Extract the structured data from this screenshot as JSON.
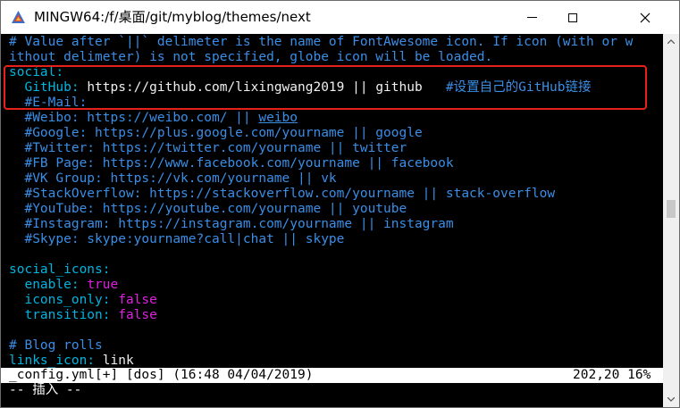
{
  "window": {
    "title": "MINGW64:/f/桌面/git/myblog/themes/next"
  },
  "editor": {
    "lines": [
      {
        "parts": [
          {
            "t": "# Value after `||` delimeter is the name of FontAwesome icon. If icon (with or w",
            "c": "c-comment"
          }
        ]
      },
      {
        "parts": [
          {
            "t": "ithout delimeter) is not specified, globe icon will be loaded.",
            "c": "c-comment"
          }
        ]
      },
      {
        "parts": [
          {
            "t": "social",
            "c": "c-key2"
          },
          {
            "t": ":",
            "c": "c-key2"
          }
        ]
      },
      {
        "parts": [
          {
            "t": "  GitHub",
            "c": "c-key2"
          },
          {
            "t": ": ",
            "c": "c-key2"
          },
          {
            "t": "https://github.com/lixingwang2019 || github",
            "c": "c-val"
          },
          {
            "t": "   #设置自己的GitHub链接",
            "c": "c-comment"
          }
        ]
      },
      {
        "parts": [
          {
            "t": "  #E-Mail:",
            "c": "c-comment"
          }
        ]
      },
      {
        "parts": [
          {
            "t": "  #Weibo: https://weibo.com/ || ",
            "c": "c-comment"
          },
          {
            "t": "weibo",
            "c": "c-comment u"
          }
        ]
      },
      {
        "parts": [
          {
            "t": "  #Google: https://plus.google.com/yourname || google",
            "c": "c-comment"
          }
        ]
      },
      {
        "parts": [
          {
            "t": "  #Twitter: https://twitter.com/yourname || twitter",
            "c": "c-comment"
          }
        ]
      },
      {
        "parts": [
          {
            "t": "  #FB Page: https://www.facebook.com/yourname || facebook",
            "c": "c-comment"
          }
        ]
      },
      {
        "parts": [
          {
            "t": "  #VK Group: https://vk.com/yourname || vk",
            "c": "c-comment"
          }
        ]
      },
      {
        "parts": [
          {
            "t": "  #StackOverflow: https://stackoverflow.com/yourname || stack-overflow",
            "c": "c-comment"
          }
        ]
      },
      {
        "parts": [
          {
            "t": "  #YouTube: https://youtube.com/yourname || youtube",
            "c": "c-comment"
          }
        ]
      },
      {
        "parts": [
          {
            "t": "  #Instagram: https://instagram.com/yourname || instagram",
            "c": "c-comment"
          }
        ]
      },
      {
        "parts": [
          {
            "t": "  #Skype: skype:yourname?call|chat || skype",
            "c": "c-comment"
          }
        ]
      },
      {
        "parts": [
          {
            "t": "",
            "c": "c-val"
          }
        ]
      },
      {
        "parts": [
          {
            "t": "social_icons",
            "c": "c-key2"
          },
          {
            "t": ":",
            "c": "c-key2"
          }
        ]
      },
      {
        "parts": [
          {
            "t": "  enable",
            "c": "c-key2"
          },
          {
            "t": ": ",
            "c": "c-key2"
          },
          {
            "t": "true",
            "c": "c-bool"
          }
        ]
      },
      {
        "parts": [
          {
            "t": "  icons_only",
            "c": "c-key2"
          },
          {
            "t": ": ",
            "c": "c-key2"
          },
          {
            "t": "false",
            "c": "c-bool"
          }
        ]
      },
      {
        "parts": [
          {
            "t": "  transition",
            "c": "c-key2"
          },
          {
            "t": ": ",
            "c": "c-key2"
          },
          {
            "t": "false",
            "c": "c-bool"
          }
        ]
      },
      {
        "parts": [
          {
            "t": "",
            "c": "c-val"
          }
        ]
      },
      {
        "parts": [
          {
            "t": "# Blog rolls",
            "c": "c-comment"
          }
        ]
      },
      {
        "parts": [
          {
            "t": "links_icon",
            "c": "c-key2"
          },
          {
            "t": ": ",
            "c": "c-key2"
          },
          {
            "t": "link",
            "c": "c-val"
          }
        ]
      }
    ],
    "status_line": "_config.yml[+] [dos] (16:48 04/04/2019)",
    "status_position": "202,20 16%",
    "mode_line": "-- 插入 --"
  },
  "colors": {
    "highlight_box": "#e8201a",
    "comment": "#3a8ee6",
    "key": "#00b4e0",
    "boolean": "#e020e0"
  },
  "icons": {
    "app": "mingw-icon",
    "minimize": "minimize-icon",
    "maximize": "maximize-icon",
    "close": "close-icon"
  }
}
